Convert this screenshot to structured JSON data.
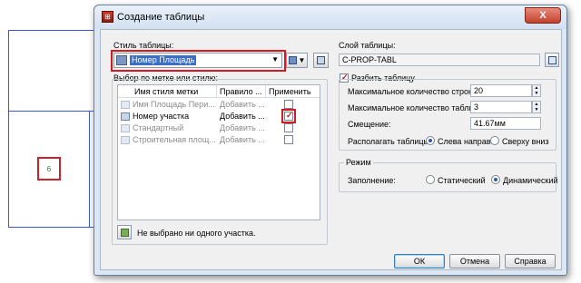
{
  "background": {
    "marker_label": "6"
  },
  "window": {
    "title": "Создание таблицы",
    "close_glyph": "X",
    "icon": "table-create-icon"
  },
  "left": {
    "style_label": "Стиль таблицы:",
    "style_value": "Номер Площадь",
    "style_icon": "table-style-icon",
    "select_group_label": "Выбор по метке или стилю:",
    "grid": {
      "headers": [
        "Имя стиля метки",
        "Правило ...",
        "Применить"
      ],
      "rows": [
        {
          "name": "Имя Площадь Пери...",
          "rule": "Добавить ...",
          "checked": false,
          "enabled": false
        },
        {
          "name": "Номер участка",
          "rule": "Добавить ...",
          "checked": true,
          "enabled": true
        },
        {
          "name": "Стандартный",
          "rule": "Добавить ...",
          "checked": false,
          "enabled": false
        },
        {
          "name": "Строительная площ...",
          "rule": "Добавить ...",
          "checked": false,
          "enabled": false
        }
      ]
    },
    "status_text": "Не выбрано ни одного участка."
  },
  "right": {
    "layer_label": "Слой таблицы:",
    "layer_value": "C-PROP-TABL",
    "split_label": "Разбить таблицу",
    "split_checked": true,
    "max_rows_label": "Максимальное количество строк в таблице:",
    "max_rows_value": "20",
    "max_tables_label": "Максимальное количество таблиц в блоке:",
    "max_tables_value": "3",
    "offset_label": "Смещение:",
    "offset_value": "41.67мм",
    "arrange_label": "Располагать таблицы:",
    "arrange_left": "Слева направо",
    "arrange_top": "Сверху вниз",
    "arrange_selected": "left",
    "mode_group_label": "Режим",
    "fill_label": "Заполнение:",
    "fill_static": "Статический",
    "fill_dynamic": "Динамический",
    "fill_selected": "dynamic"
  },
  "buttons": {
    "ok": "ОК",
    "cancel": "Отмена",
    "help": "Справка"
  },
  "colors": {
    "highlight": "#d11a24",
    "selection": "#3a6fc6",
    "drawing_lines": "#3b5bd6"
  }
}
